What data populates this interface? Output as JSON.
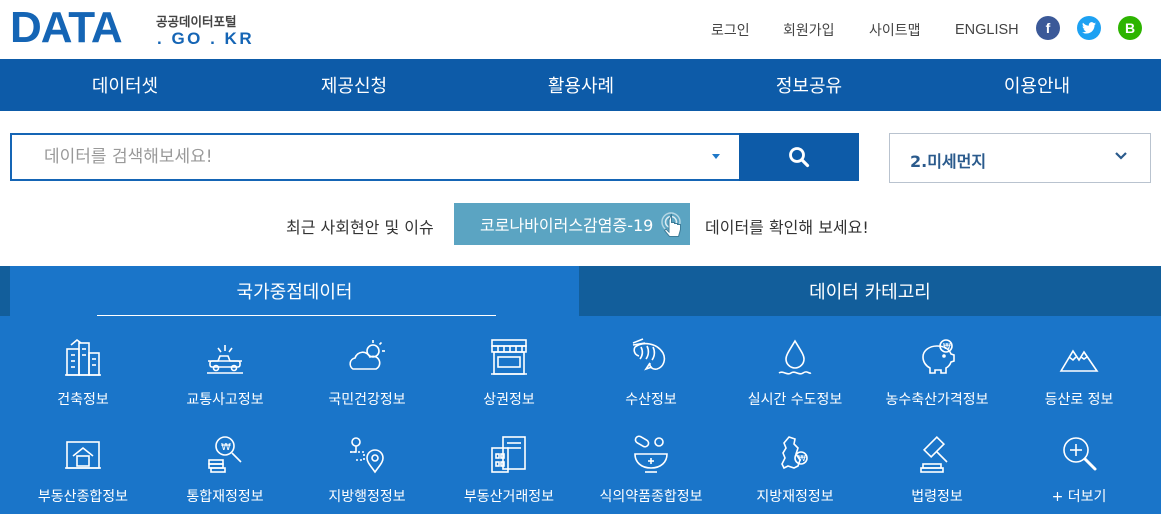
{
  "logo": {
    "word": "DATA",
    "korean": "공공데이터포털",
    "domain": ". GO . KR"
  },
  "util_nav": {
    "login": "로그인",
    "signup": "회원가입",
    "sitemap": "사이트맵",
    "english": "ENGLISH"
  },
  "sns": {
    "facebook": "f",
    "twitter": "t",
    "blog": "B"
  },
  "colors": {
    "primary": "#0d5ba8",
    "panel": "#1a75c9",
    "tab_inactive": "#125e9b",
    "issue_button": "#5ba4c2",
    "facebook": "#3b5998",
    "twitter": "#1da1f2",
    "blog": "#2db400"
  },
  "gnb": [
    "데이터셋",
    "제공신청",
    "활용사례",
    "정보공유",
    "이용안내"
  ],
  "search": {
    "placeholder": "데이터를 검색해보세요!",
    "value": ""
  },
  "select": {
    "value": "2.미세먼지"
  },
  "issue": {
    "prefix": "최근 사회현안 및 이슈",
    "button": "코로나바이러스감염증-19",
    "suffix": "데이터를 확인해 보세요!"
  },
  "tabs": {
    "active": "국가중점데이터",
    "inactive": "데이터 카테고리"
  },
  "categories": [
    {
      "label": "건축정보",
      "icon": "building-icon"
    },
    {
      "label": "교통사고정보",
      "icon": "car-accident-icon"
    },
    {
      "label": "국민건강정보",
      "icon": "weather-health-icon"
    },
    {
      "label": "상권정보",
      "icon": "storefront-icon"
    },
    {
      "label": "수산정보",
      "icon": "shrimp-icon"
    },
    {
      "label": "실시간 수도정보",
      "icon": "water-drop-icon"
    },
    {
      "label": "농수축산가격정보",
      "icon": "piggy-bank-icon"
    },
    {
      "label": "등산로 정보",
      "icon": "mountain-icon"
    },
    {
      "label": "부동산종합정보",
      "icon": "house-icon"
    },
    {
      "label": "통합재정정보",
      "icon": "coins-search-icon"
    },
    {
      "label": "지방행정정보",
      "icon": "map-pin-route-icon"
    },
    {
      "label": "부동산거래정보",
      "icon": "document-building-icon"
    },
    {
      "label": "식의약품종합정보",
      "icon": "pill-bowl-icon"
    },
    {
      "label": "지방재정정보",
      "icon": "korea-map-won-icon"
    },
    {
      "label": "법령정보",
      "icon": "gavel-icon"
    },
    {
      "label": "+ 더보기",
      "icon": "magnifier-plus-icon"
    }
  ]
}
